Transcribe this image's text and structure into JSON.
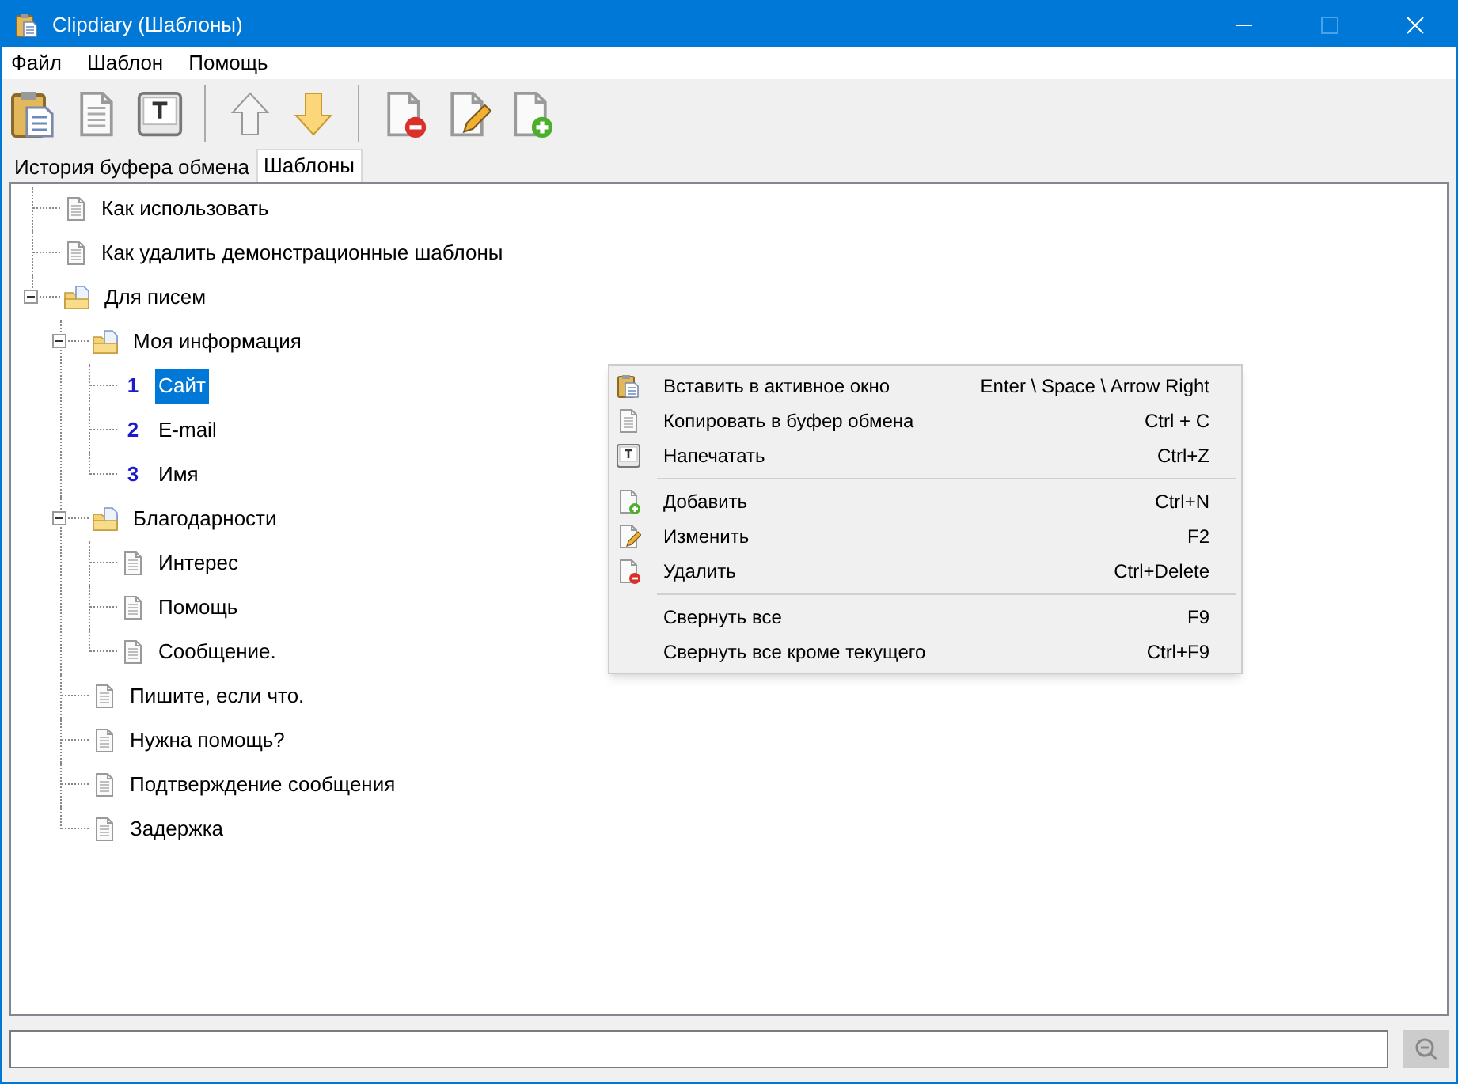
{
  "window": {
    "title": "Clipdiary (Шаблоны)"
  },
  "menu": [
    "Файл",
    "Шаблон",
    "Помощь"
  ],
  "tabs": [
    {
      "label": "История буфера обмена",
      "selected": false
    },
    {
      "label": "Шаблоны",
      "selected": true
    }
  ],
  "tree": [
    {
      "kind": "doc",
      "label": "Как использовать",
      "selected": false
    },
    {
      "kind": "doc",
      "label": "Как удалить демонстрационные шаблоны",
      "selected": false
    },
    {
      "kind": "folder",
      "label": "Для писем",
      "selected": false,
      "expanded": true,
      "children": [
        {
          "kind": "folder",
          "label": "Моя информация",
          "selected": false,
          "expanded": true,
          "children": [
            {
              "kind": "numbered",
              "number": "1",
              "label": "Сайт",
              "selected": true
            },
            {
              "kind": "numbered",
              "number": "2",
              "label": "E-mail",
              "selected": false
            },
            {
              "kind": "numbered",
              "number": "3",
              "label": "Имя",
              "selected": false
            }
          ]
        },
        {
          "kind": "folder",
          "label": "Благодарности",
          "selected": false,
          "expanded": true,
          "children": [
            {
              "kind": "doc",
              "label": "Интерес",
              "selected": false
            },
            {
              "kind": "doc",
              "label": "Помощь",
              "selected": false
            },
            {
              "kind": "doc",
              "label": "Сообщение.",
              "selected": false
            }
          ]
        },
        {
          "kind": "doc",
          "label": "Пишите, если что.",
          "selected": false
        },
        {
          "kind": "doc",
          "label": "Нужна помощь?",
          "selected": false
        },
        {
          "kind": "doc",
          "label": "Подтверждение сообщения",
          "selected": false
        },
        {
          "kind": "doc",
          "label": "Задержка",
          "selected": false
        }
      ]
    }
  ],
  "context_menu": [
    [
      {
        "label": "Вставить в активное окно",
        "shortcut": "Enter \\ Space \\ Arrow Right"
      },
      {
        "label": "Копировать в буфер обмена",
        "shortcut": "Ctrl + C"
      },
      {
        "label": "Напечатать",
        "shortcut": "Ctrl+Z"
      }
    ],
    [
      {
        "label": "Добавить",
        "shortcut": "Ctrl+N"
      },
      {
        "label": "Изменить",
        "shortcut": "F2"
      },
      {
        "label": "Удалить",
        "shortcut": "Ctrl+Delete"
      }
    ],
    [
      {
        "label": "Свернуть все",
        "shortcut": "F9"
      },
      {
        "label": "Свернуть все кроме текущего",
        "shortcut": "Ctrl+F9"
      }
    ]
  ]
}
